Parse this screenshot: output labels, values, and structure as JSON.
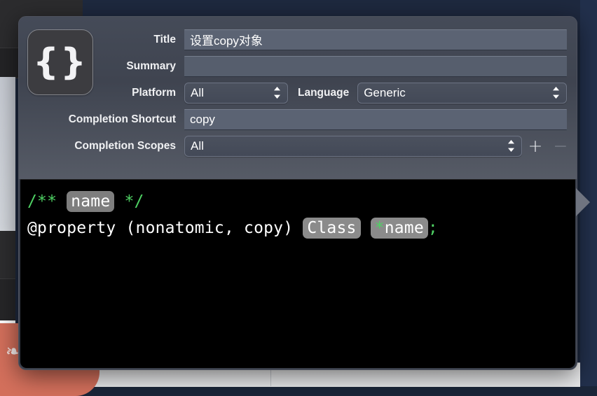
{
  "window": {
    "kind": "code-snippet-editor-popover"
  },
  "snippet_icon": {
    "glyph": "{}",
    "name": "braces-icon"
  },
  "form": {
    "title": {
      "label": "Title",
      "value": "设置copy对象",
      "placeholder": ""
    },
    "summary": {
      "label": "Summary",
      "value": "",
      "placeholder": ""
    },
    "platform": {
      "label": "Platform",
      "value": "All",
      "options": [
        "All"
      ]
    },
    "language": {
      "label": "Language",
      "value": "Generic",
      "options": [
        "Generic"
      ]
    },
    "completion_shortcut": {
      "label": "Completion Shortcut",
      "value": "copy",
      "placeholder": ""
    },
    "completion_scopes": {
      "label": "Completion Scopes",
      "value": "All",
      "options": [
        "All"
      ]
    },
    "add_button": {
      "label": "+",
      "name": "add-scope-button"
    },
    "remove_button": {
      "label": "−",
      "name": "remove-scope-button"
    }
  },
  "editor": {
    "line1": {
      "prefix": "/** ",
      "placeholder": "name",
      "suffix": " */"
    },
    "line2": {
      "part1": "@property (nonatomic, copy) ",
      "placeholder1": "Class",
      "space": " ",
      "star": "*",
      "placeholder2": "name",
      "semicolon": ";"
    }
  },
  "colors": {
    "popover_bg": "#3a3f4b",
    "field_bg": "#5b6373",
    "editor_bg": "#000000",
    "comment_green": "#4fd264",
    "placeholder_bg": "#8b8b8b",
    "desktop_navy": "#1e293f",
    "dock_orange": "#d4705c"
  },
  "desktop": {
    "dock_glyph": "❧"
  }
}
